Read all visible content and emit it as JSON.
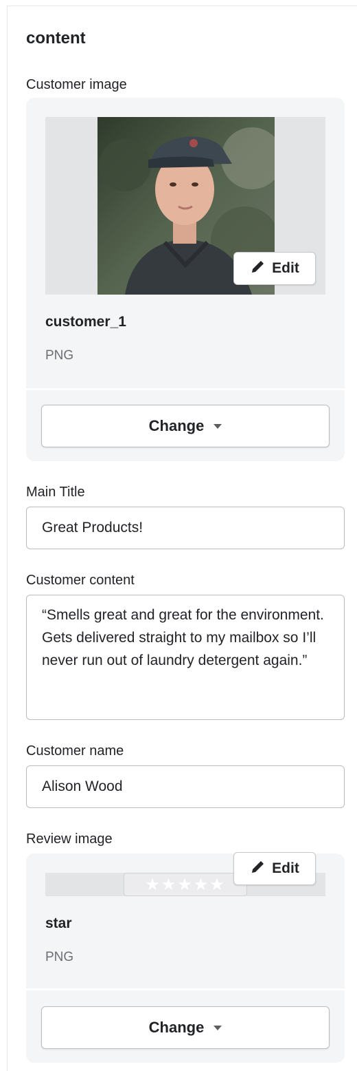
{
  "section": {
    "title": "content"
  },
  "customer_image": {
    "label": "Customer image",
    "file_name": "customer_1",
    "file_type": "PNG",
    "edit_label": "Edit",
    "change_label": "Change"
  },
  "main_title": {
    "label": "Main Title",
    "value": "Great Products!"
  },
  "customer_content": {
    "label": "Customer content",
    "value": "“Smells great and great for the environment. Gets delivered straight to my mailbox so I’ll never run out of laundry detergent again.”"
  },
  "customer_name": {
    "label": "Customer name",
    "value": "Alison Wood"
  },
  "review_image": {
    "label": "Review image",
    "file_name": "star",
    "file_type": "PNG",
    "edit_label": "Edit",
    "change_label": "Change",
    "stars": "★★★★★"
  },
  "icons": {
    "edit": "pencil-icon",
    "change": "caret-down-icon"
  }
}
